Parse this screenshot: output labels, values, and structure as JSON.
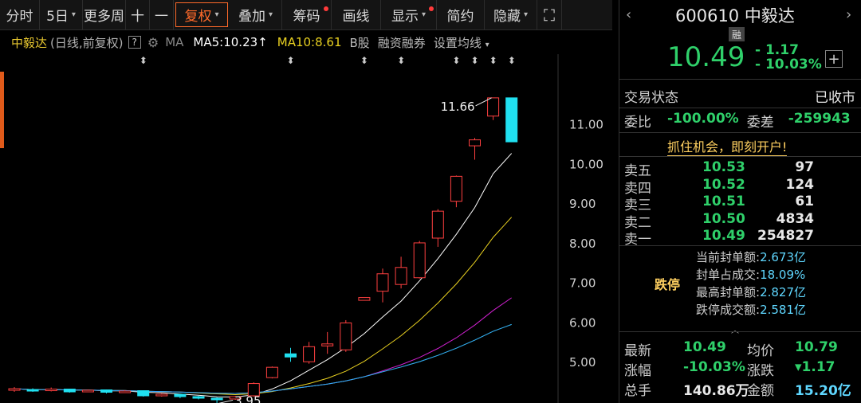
{
  "toolbar": {
    "items": [
      {
        "label": "分时",
        "caret": false,
        "dot": false,
        "active": false,
        "w": 50
      },
      {
        "label": "5日",
        "caret": true,
        "dot": false,
        "active": false,
        "w": 54
      },
      {
        "label": "更多周",
        "caret": false,
        "dot": false,
        "active": false,
        "w": 54
      },
      {
        "label": "十",
        "caret": false,
        "dot": false,
        "active": false,
        "w": 30
      },
      {
        "label": "一",
        "caret": false,
        "dot": false,
        "active": false,
        "w": 30
      },
      {
        "label": "复权",
        "caret": true,
        "dot": false,
        "active": true,
        "w": 66
      },
      {
        "label": "叠加",
        "caret": true,
        "dot": false,
        "active": false,
        "w": 66
      },
      {
        "label": "筹码",
        "caret": false,
        "dot": true,
        "active": false,
        "w": 62
      },
      {
        "label": "画线",
        "caret": false,
        "dot": false,
        "active": false,
        "w": 62
      },
      {
        "label": "显示",
        "caret": true,
        "dot": true,
        "active": false,
        "w": 70
      },
      {
        "label": "简约",
        "caret": false,
        "dot": false,
        "active": false,
        "w": 60
      },
      {
        "label": "隐藏",
        "caret": true,
        "dot": false,
        "active": false,
        "w": 66
      }
    ],
    "expand_icon": "expand-icon"
  },
  "chart_head": {
    "name": "中毅达",
    "sub": "(日线,前复权)",
    "help": "?",
    "ma_label": "MA",
    "ma5": "MA5:10.23",
    "ma5_arrow": "↑",
    "ma10": "MA10:8.61",
    "b_share": "B股",
    "margin": "融资融券",
    "set_ma": "设置均线"
  },
  "chart_data": {
    "type": "candlestick",
    "y_ticks": [
      "11.00",
      "10.00",
      "9.00",
      "8.00",
      "7.00",
      "6.00",
      "5.00"
    ],
    "ylim": [
      4.2,
      12.2
    ],
    "high_label": "11.66",
    "low_label": "3.95",
    "candles": [
      {
        "o": 4.28,
        "c": 4.32,
        "h": 4.36,
        "l": 4.24
      },
      {
        "o": 4.3,
        "c": 4.27,
        "h": 4.33,
        "l": 4.24
      },
      {
        "o": 4.28,
        "c": 4.31,
        "h": 4.35,
        "l": 4.25
      },
      {
        "o": 4.31,
        "c": 4.24,
        "h": 4.32,
        "l": 4.22
      },
      {
        "o": 4.26,
        "c": 4.28,
        "h": 4.3,
        "l": 4.23
      },
      {
        "o": 4.29,
        "c": 4.23,
        "h": 4.3,
        "l": 4.2
      },
      {
        "o": 4.23,
        "c": 4.26,
        "h": 4.28,
        "l": 4.21
      },
      {
        "o": 4.27,
        "c": 4.14,
        "h": 4.28,
        "l": 4.12
      },
      {
        "o": 4.15,
        "c": 4.18,
        "h": 4.2,
        "l": 4.12
      },
      {
        "o": 4.18,
        "c": 4.12,
        "h": 4.19,
        "l": 4.08
      },
      {
        "o": 4.12,
        "c": 4.08,
        "h": 4.14,
        "l": 4.05
      },
      {
        "o": 4.08,
        "c": 4.05,
        "h": 4.1,
        "l": 3.95
      },
      {
        "o": 4.06,
        "c": 4.12,
        "h": 4.14,
        "l": 4.04
      },
      {
        "o": 4.14,
        "c": 4.45,
        "h": 4.48,
        "l": 4.12
      },
      {
        "o": 4.6,
        "c": 4.86,
        "h": 4.88,
        "l": 4.58
      },
      {
        "o": 5.2,
        "c": 5.12,
        "h": 5.35,
        "l": 5.0
      },
      {
        "o": 5.0,
        "c": 5.38,
        "h": 5.5,
        "l": 4.95
      },
      {
        "o": 5.4,
        "c": 5.45,
        "h": 5.75,
        "l": 5.2
      },
      {
        "o": 5.3,
        "c": 5.98,
        "h": 6.05,
        "l": 5.25
      },
      {
        "o": 6.55,
        "c": 6.62,
        "h": 6.62,
        "l": 6.55
      },
      {
        "o": 6.78,
        "c": 7.22,
        "h": 7.35,
        "l": 6.5
      },
      {
        "o": 6.95,
        "c": 7.38,
        "h": 7.65,
        "l": 6.85
      },
      {
        "o": 7.12,
        "c": 8.0,
        "h": 8.05,
        "l": 7.1
      },
      {
        "o": 8.12,
        "c": 8.8,
        "h": 8.85,
        "l": 7.9
      },
      {
        "o": 9.05,
        "c": 9.68,
        "h": 9.7,
        "l": 8.9
      },
      {
        "o": 10.45,
        "c": 10.6,
        "h": 10.65,
        "l": 10.1
      },
      {
        "o": 11.2,
        "c": 11.66,
        "h": 11.66,
        "l": 11.1
      },
      {
        "o": 11.66,
        "c": 10.55,
        "h": 11.66,
        "l": 10.55
      }
    ],
    "markers": [
      7,
      15,
      19,
      21,
      24,
      25,
      26,
      27
    ]
  },
  "right_panel": {
    "nav_left": "‹",
    "nav_right": "›",
    "code": "600610",
    "name": "中毅达",
    "margin_tag": "融",
    "price": "10.49",
    "change": "- 1.17",
    "change_pct": "- 10.03%",
    "status_label": "交易状态",
    "status_value": "已收市",
    "weibi_label": "委比",
    "weibi_value": "-100.00%",
    "weicha_label": "委差",
    "weicha_value": "-259943",
    "promo": "抓住机会，即刻开户!",
    "asks": [
      {
        "label": "卖五",
        "price": "10.53",
        "vol": "97"
      },
      {
        "label": "卖四",
        "price": "10.52",
        "vol": "124"
      },
      {
        "label": "卖三",
        "price": "10.51",
        "vol": "61"
      },
      {
        "label": "卖二",
        "price": "10.50",
        "vol": "4834"
      },
      {
        "label": "卖一",
        "price": "10.49",
        "vol": "254827"
      }
    ],
    "limit_label": "跌停",
    "limit_info": [
      {
        "k": "当前封单额:",
        "v": "2.673亿"
      },
      {
        "k": "封单占成交:",
        "v": "18.09%"
      },
      {
        "k": "最高封单额:",
        "v": "2.827亿"
      },
      {
        "k": "跌停成交额:",
        "v": "2.581亿"
      }
    ],
    "stats": [
      {
        "k": "最新",
        "v": "10.49",
        "k2": "均价",
        "v2": "10.79"
      },
      {
        "k": "涨幅",
        "v": "-10.03%",
        "k2": "涨跌",
        "v2": "▾1.17"
      },
      {
        "k": "总手",
        "v": "140.86万",
        "k2": "金额",
        "v2": "15.20亿"
      }
    ]
  }
}
